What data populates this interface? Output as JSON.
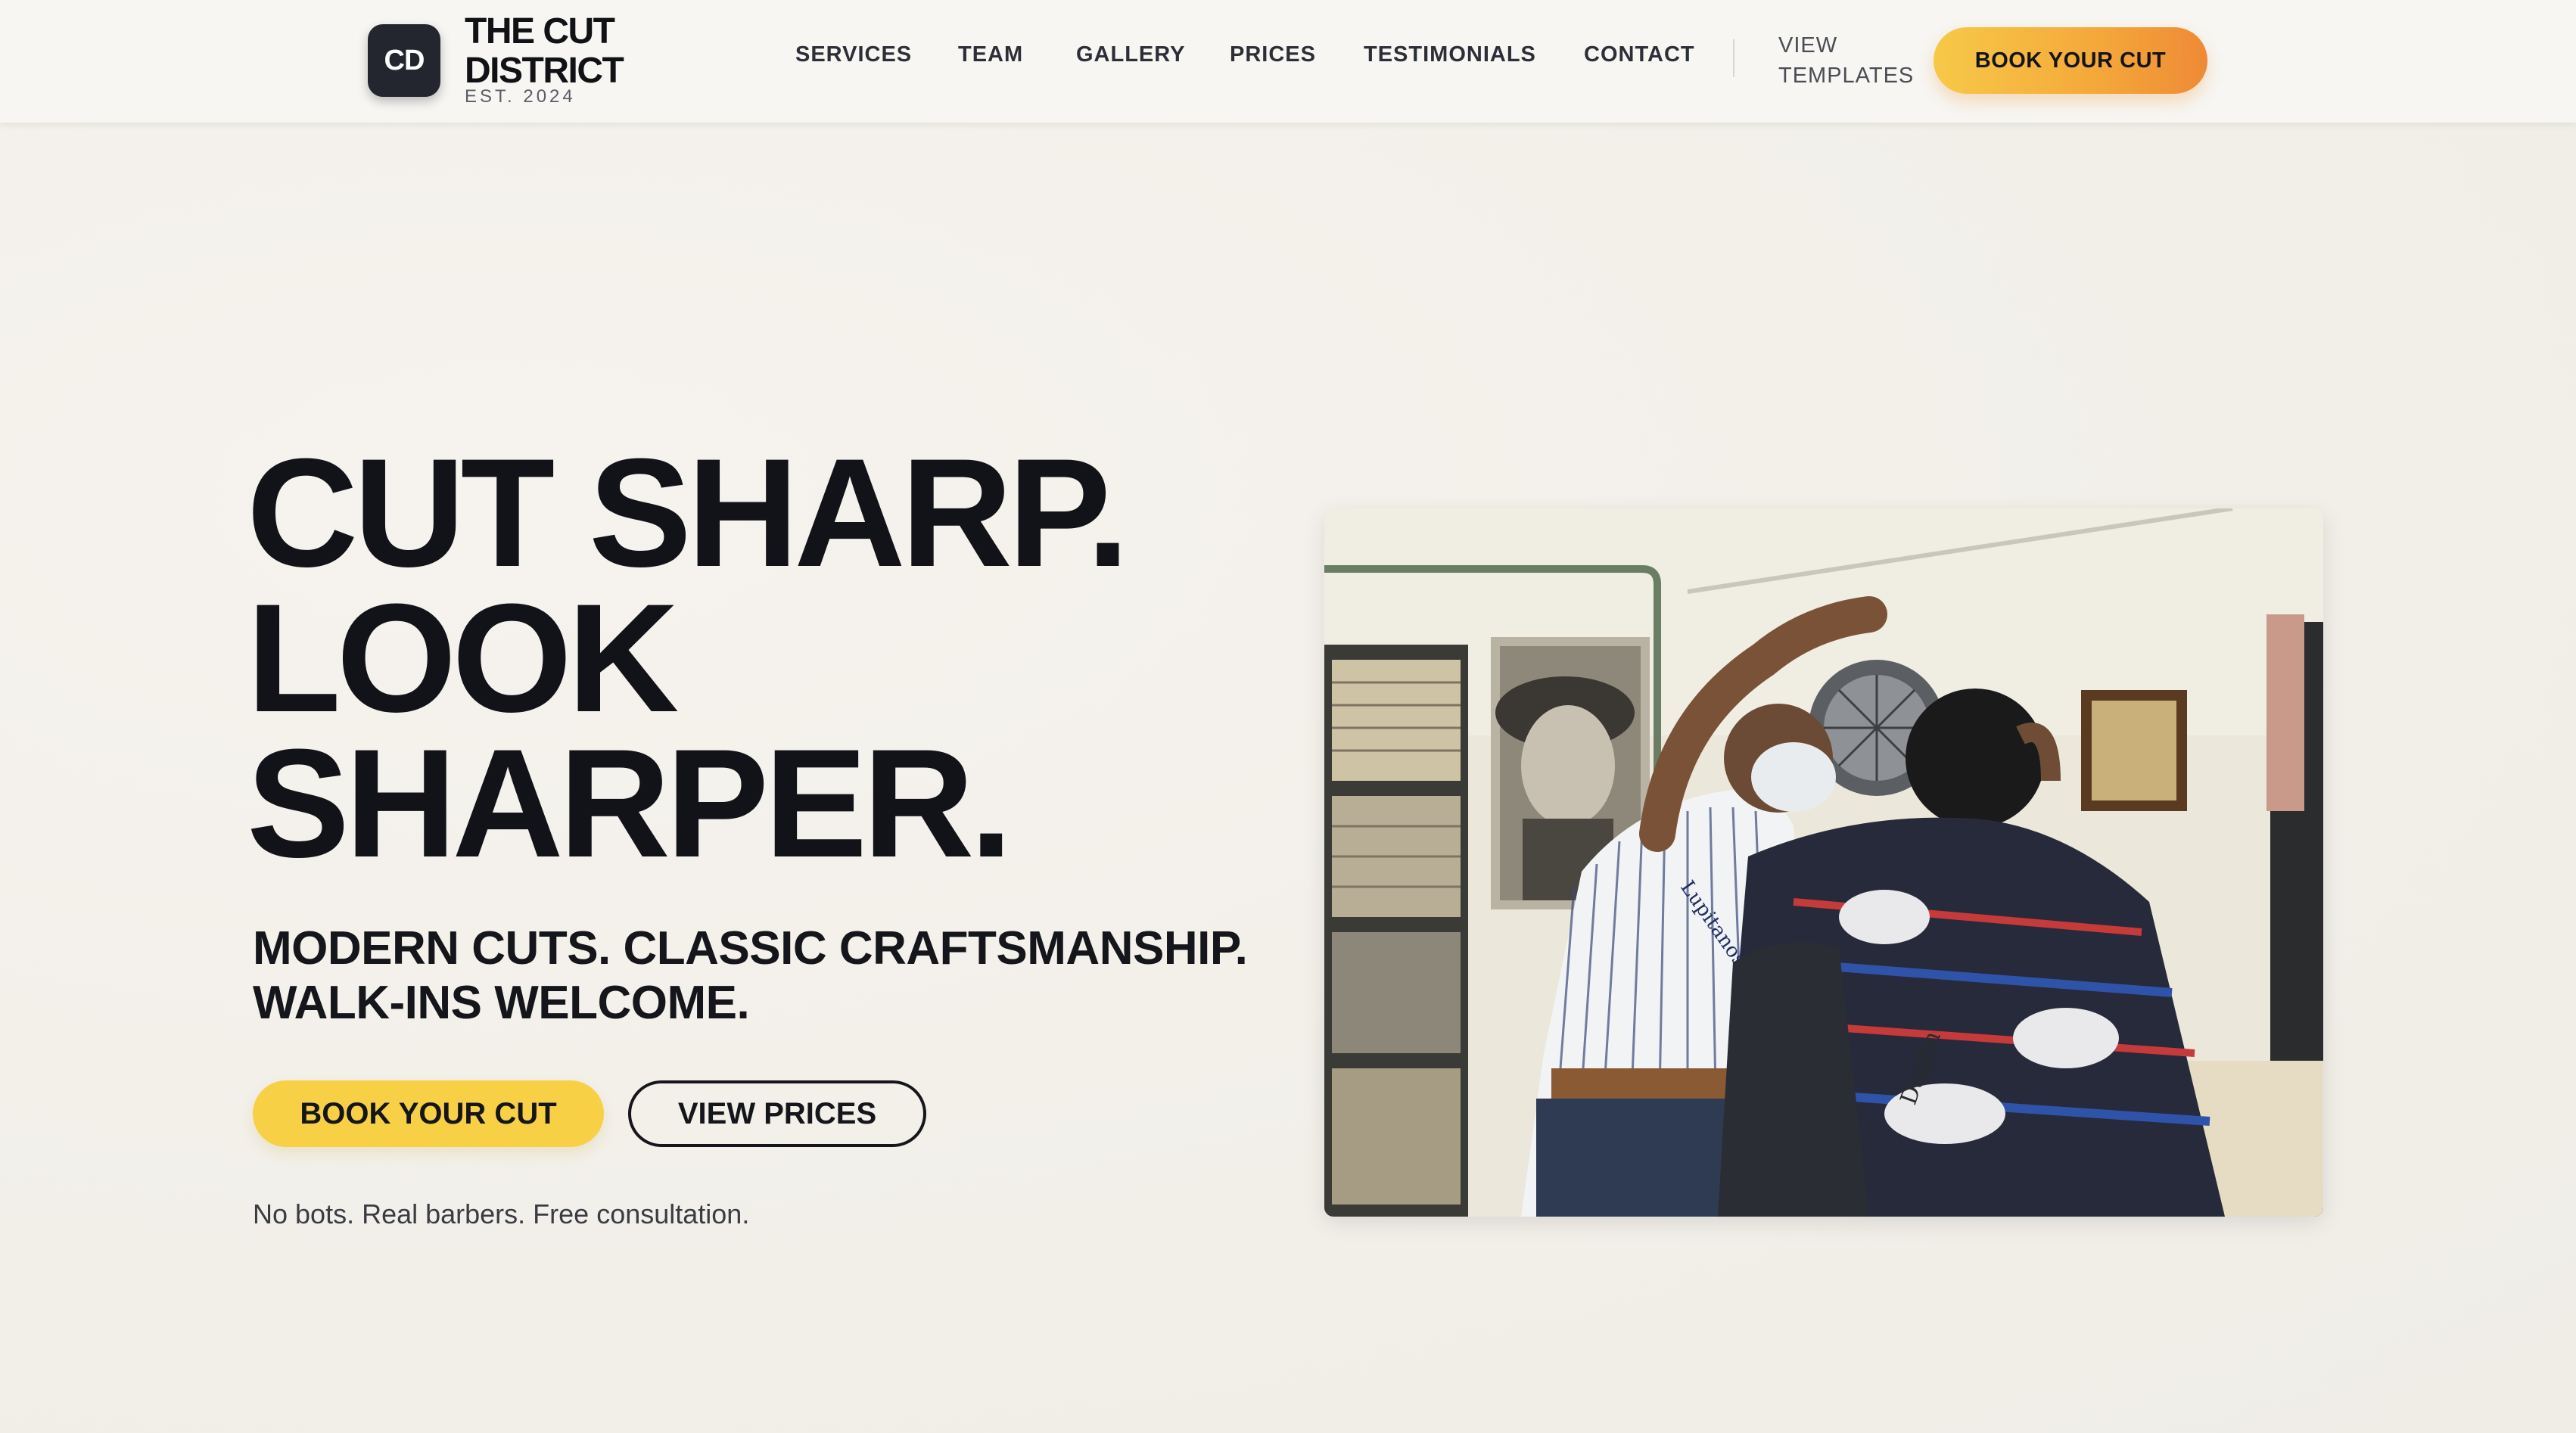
{
  "brand": {
    "badge": "CD",
    "name": "THE CUT DISTRICT",
    "est": "EST. 2024"
  },
  "nav": {
    "items": [
      {
        "label": "SERVICES"
      },
      {
        "label": "TEAM"
      },
      {
        "label": "GALLERY"
      },
      {
        "label": "PRICES"
      },
      {
        "label": "TESTIMONIALS"
      },
      {
        "label": "CONTACT"
      }
    ],
    "view_templates": "VIEW TEMPLATES",
    "cta": "BOOK YOUR CUT"
  },
  "hero": {
    "title_lines": [
      "CUT SHARP.",
      "LOOK",
      "SHARPER."
    ],
    "subtitle_lines": [
      "MODERN CUTS. CLASSIC CRAFTSMANSHIP.",
      "WALK-INS WELCOME."
    ],
    "primary_button": "BOOK YOUR CUT",
    "secondary_button": "VIEW PRICES",
    "note": "No bots. Real barbers. Free consultation."
  },
  "photo": {
    "subject": "barber cutting a customer's hair in a shop",
    "shirt_script": "Lupitanos",
    "cape_script": "Dagfin"
  },
  "colors": {
    "accent_yellow": "#f7d046",
    "accent_orange": "#ee8a36",
    "dark": "#23262f",
    "background": "#f3f0eb"
  }
}
